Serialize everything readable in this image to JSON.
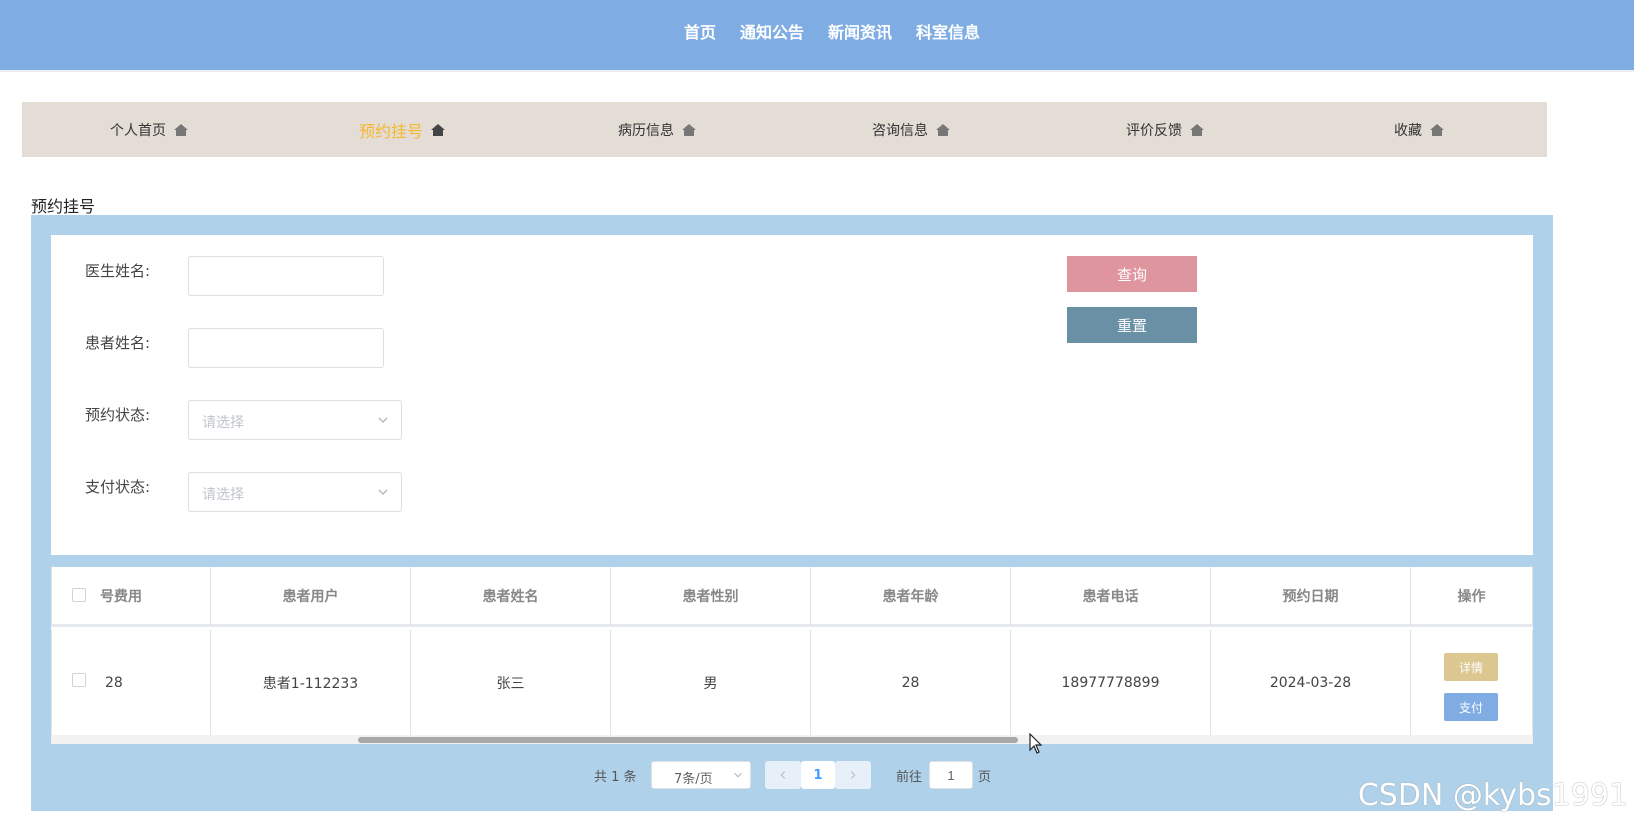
{
  "top_nav": [
    "首页",
    "通知公告",
    "新闻资讯",
    "科室信息"
  ],
  "sub_nav": [
    {
      "label": "个人首页",
      "active": false
    },
    {
      "label": "预约挂号",
      "active": true
    },
    {
      "label": "病历信息",
      "active": false
    },
    {
      "label": "咨询信息",
      "active": false
    },
    {
      "label": "评价反馈",
      "active": false
    },
    {
      "label": "收藏",
      "active": false
    }
  ],
  "section_title": "预约挂号",
  "search": {
    "doctor_name_label": "医生姓名:",
    "doctor_name_value": "",
    "patient_name_label": "患者姓名:",
    "patient_name_value": "",
    "appt_status_label": "预约状态:",
    "appt_status_placeholder": "请选择",
    "pay_status_label": "支付状态:",
    "pay_status_placeholder": "请选择",
    "query_button": "查询",
    "reset_button": "重置"
  },
  "table": {
    "columns": [
      "号费用",
      "患者用户",
      "患者姓名",
      "患者性别",
      "患者年龄",
      "患者电话",
      "预约日期",
      "操作"
    ],
    "rows": [
      {
        "fee": "28",
        "user": "患者1-112233",
        "name": "张三",
        "gender": "男",
        "age": "28",
        "phone": "18977778899",
        "date": "2024-03-28",
        "detail": "详情",
        "pay": "支付"
      }
    ]
  },
  "pagination": {
    "total": "共 1 条",
    "page_size": "7条/页",
    "current_page": "1",
    "goto_label": "前往",
    "goto_value": "1",
    "page_suffix": "页"
  },
  "watermark": "CSDN @kybs1991",
  "colors": {
    "header": "#7fade3",
    "subnav_bg": "#e3ddd6",
    "active_tab": "#f5b82e",
    "panel": "#afd2ea",
    "query_btn": "#df959d",
    "reset_btn": "#6990a4",
    "detail_btn": "#dcc790",
    "pay_btn": "#7fade3"
  }
}
